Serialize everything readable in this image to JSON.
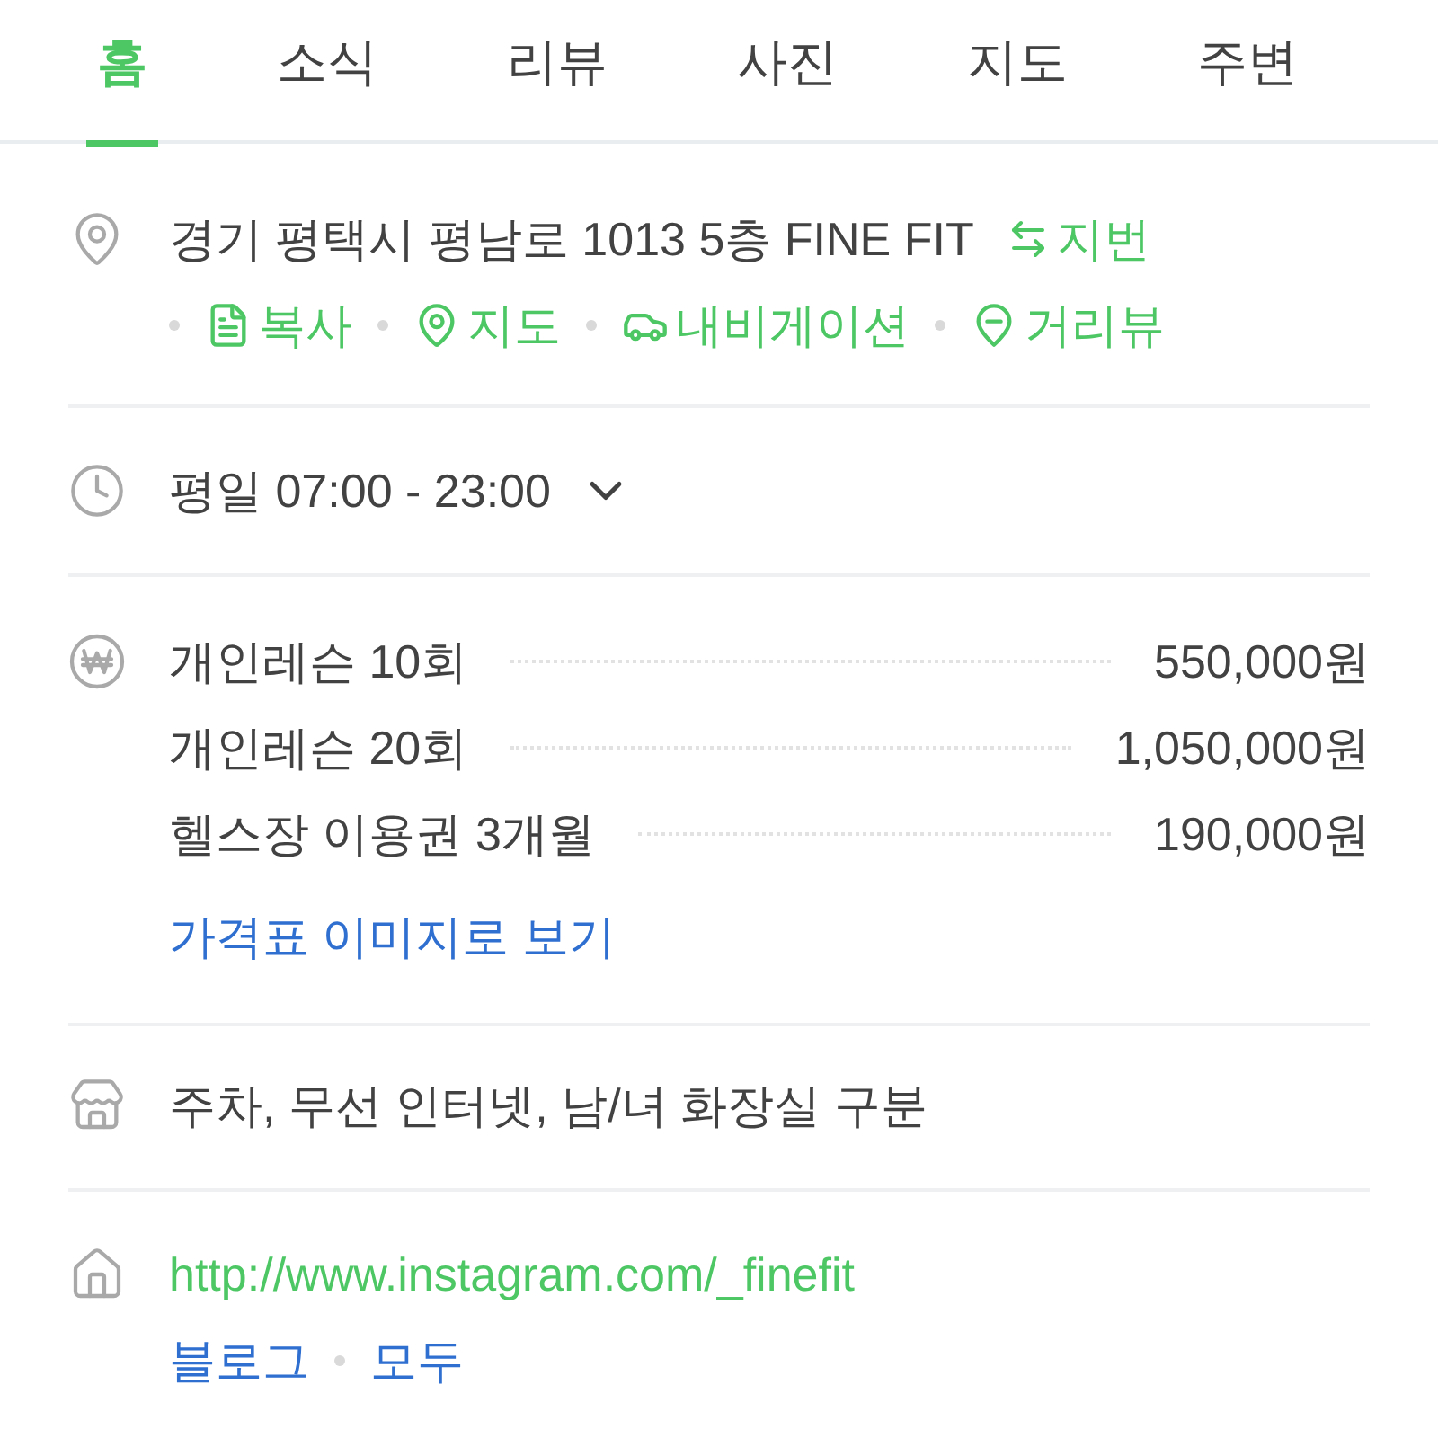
{
  "tabs": [
    {
      "label": "홈",
      "selected": true
    },
    {
      "label": "소식",
      "selected": false
    },
    {
      "label": "리뷰",
      "selected": false
    },
    {
      "label": "사진",
      "selected": false
    },
    {
      "label": "지도",
      "selected": false
    },
    {
      "label": "주변",
      "selected": false
    }
  ],
  "address": {
    "text": "경기 평택시 평남로 1013 5층 FINE FIT",
    "toggle": "지번",
    "actions": [
      {
        "kind": "copy",
        "label": "복사"
      },
      {
        "kind": "map",
        "label": "지도"
      },
      {
        "kind": "navigation",
        "label": "내비게이션"
      },
      {
        "kind": "street_view",
        "label": "거리뷰"
      }
    ]
  },
  "hours": {
    "text": "평일 07:00 - 23:00",
    "expanded": false
  },
  "prices": {
    "items": [
      {
        "name": "개인레슨 10회",
        "price": "550,000원"
      },
      {
        "name": "개인레슨 20회",
        "price": "1,050,000원"
      },
      {
        "name": "헬스장 이용권 3개월",
        "price": "190,000원"
      }
    ],
    "link": "가격표 이미지로 보기"
  },
  "amenities": {
    "text": "주차, 무선 인터넷, 남/녀 화장실 구분"
  },
  "homepage": {
    "url": "http://www.instagram.com/_finefit",
    "links": [
      "블로그",
      "모두"
    ]
  }
}
